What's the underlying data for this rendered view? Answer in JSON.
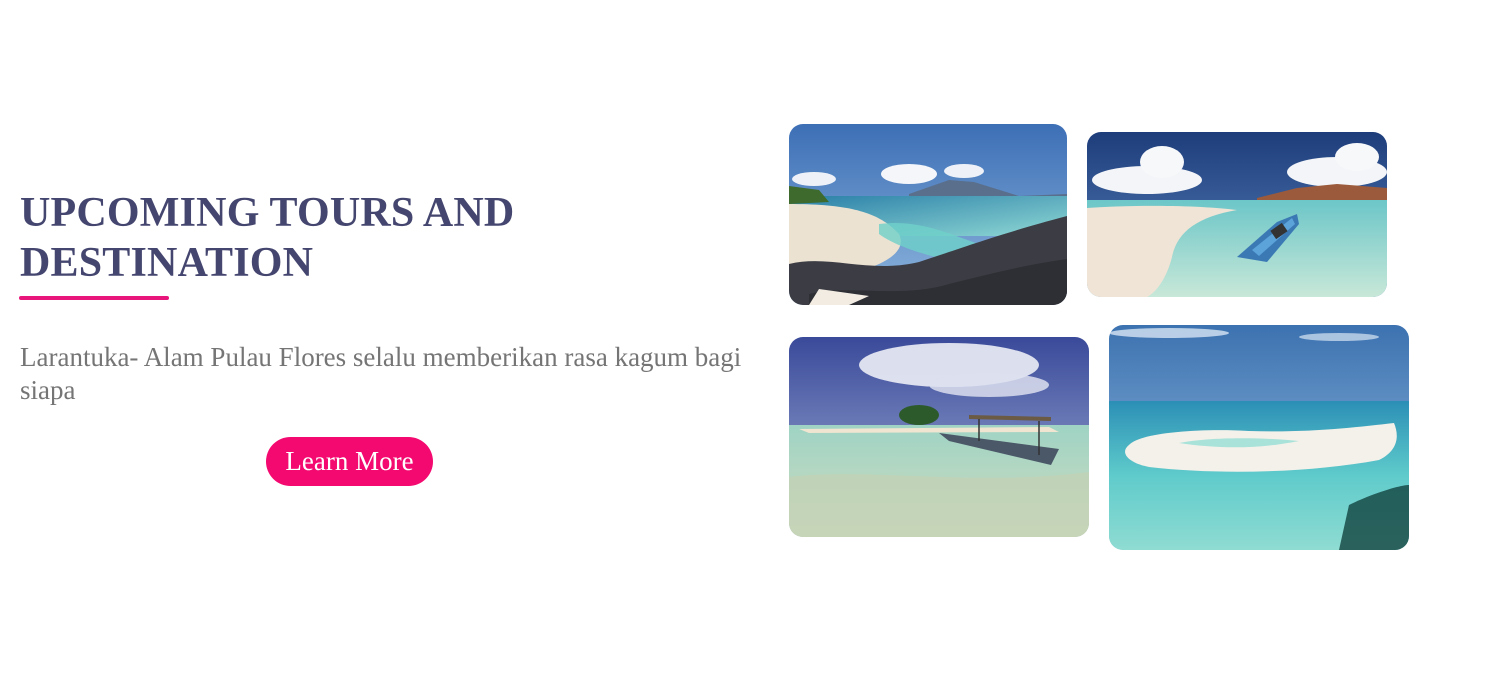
{
  "section": {
    "title": "UPCOMING TOURS AND DESTINATION",
    "description": "Larantuka- Alam Pulau Flores selalu memberikan rasa kagum bagi siapa",
    "cta_label": "Learn More"
  },
  "colors": {
    "title": "#44466f",
    "accent": "#e8157a",
    "button": "#f3096f",
    "text": "#757575"
  },
  "gallery": [
    {
      "name": "beach-rocky-shore-photo"
    },
    {
      "name": "sandbar-boat-photo"
    },
    {
      "name": "island-longboat-photo"
    },
    {
      "name": "white-sandbar-lagoon-photo"
    }
  ]
}
